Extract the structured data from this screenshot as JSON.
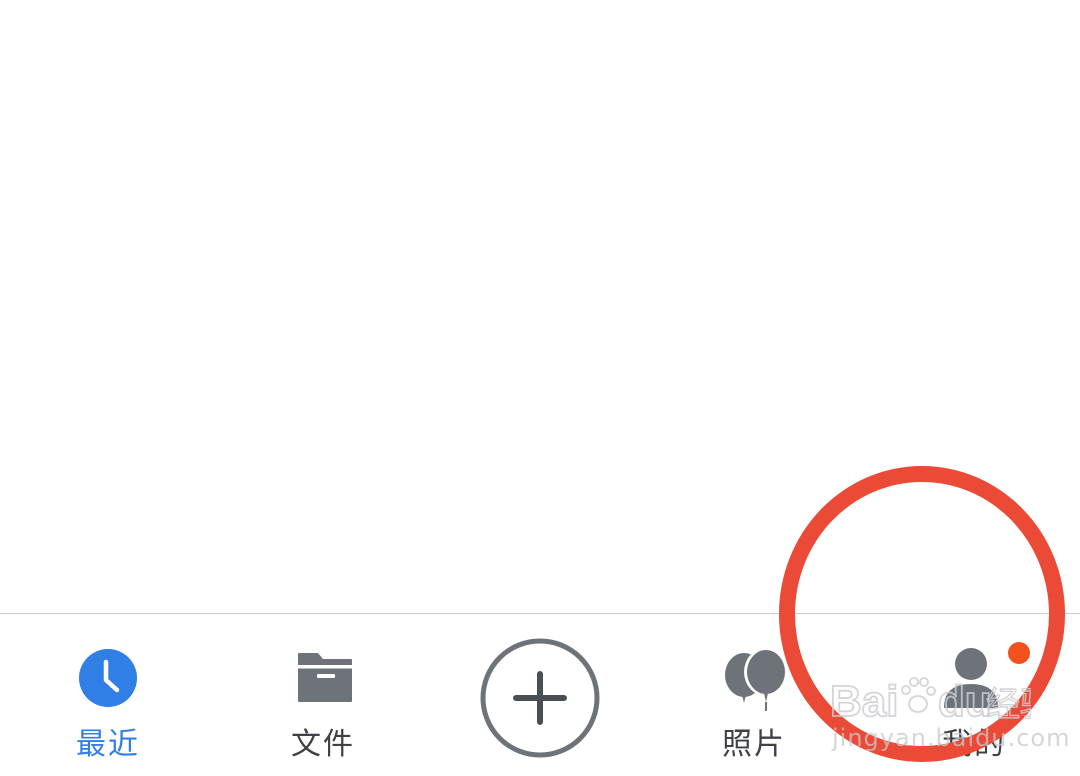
{
  "tabbar": {
    "tabs": [
      {
        "label": "最近",
        "icon": "clock-icon",
        "active": true
      },
      {
        "label": "文件",
        "icon": "folder-icon",
        "active": false
      },
      {
        "label": "",
        "icon": "add-circle-icon",
        "active": false
      },
      {
        "label": "照片",
        "icon": "balloons-icon",
        "active": false
      },
      {
        "label": "我的",
        "icon": "person-icon",
        "active": false,
        "badge": true
      }
    ]
  },
  "watermark": {
    "logo_text": "Baidu经验",
    "url": "jingyan.baidu.com"
  },
  "colors": {
    "active_tab": "#2f7fe6",
    "inactive_icon": "#6e737a",
    "inactive_label": "#3e4247",
    "badge": "#f4511e",
    "annotation_circle": "#ea4a36",
    "divider": "#c7c9cc"
  }
}
